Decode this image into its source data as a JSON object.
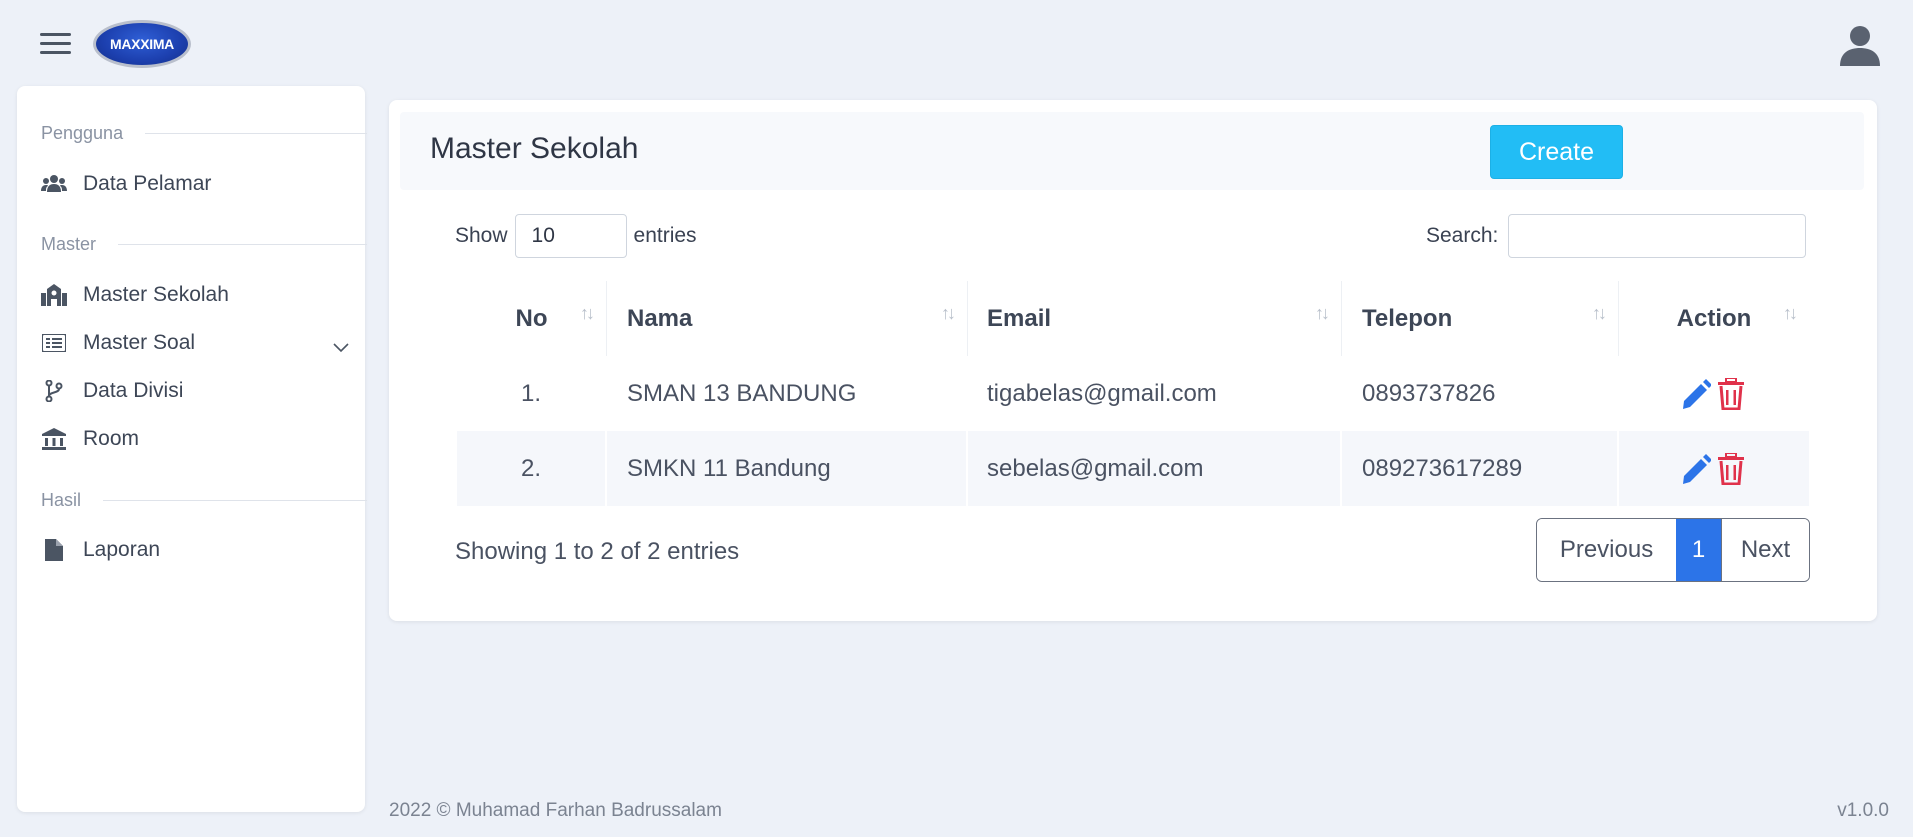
{
  "topbar": {
    "logo_text": "MAXXIMA",
    "icons": {
      "menu": "hamburger-icon",
      "user": "user-icon"
    }
  },
  "sidebar": {
    "sections": [
      {
        "title": "Pengguna",
        "items": [
          {
            "label": "Data Pelamar",
            "icon": "users-icon"
          }
        ]
      },
      {
        "title": "Master",
        "items": [
          {
            "label": "Master Sekolah",
            "icon": "school-icon"
          },
          {
            "label": "Master Soal",
            "icon": "list-icon",
            "has_submenu": true
          },
          {
            "label": "Data Divisi",
            "icon": "branch-icon"
          },
          {
            "label": "Room",
            "icon": "building-icon"
          }
        ]
      },
      {
        "title": "Hasil",
        "items": [
          {
            "label": "Laporan",
            "icon": "file-icon"
          }
        ]
      }
    ]
  },
  "main": {
    "title": "Master Sekolah",
    "create_label": "Create",
    "length": {
      "prefix": "Show",
      "value": "10",
      "suffix": "entries"
    },
    "search": {
      "label": "Search:",
      "value": ""
    },
    "table": {
      "columns": [
        "No",
        "Nama",
        "Email",
        "Telepon",
        "Action"
      ],
      "rows": [
        {
          "no": "1.",
          "nama": "SMAN 13 BANDUNG",
          "email": "tigabelas@gmail.com",
          "telepon": "0893737826"
        },
        {
          "no": "2.",
          "nama": "SMKN 11 Bandung",
          "email": "sebelas@gmail.com",
          "telepon": "089273617289"
        }
      ]
    },
    "info": "Showing 1 to 2 of 2 entries",
    "pagination": {
      "previous": "Previous",
      "current": "1",
      "next": "Next"
    }
  },
  "footer": {
    "copyright": "2022 © Muhamad Farhan Badrussalam",
    "version": "v1.0.0"
  },
  "colors": {
    "primary": "#2c74e8",
    "create": "#22bdf5",
    "delete": "#e0324b",
    "background": "#edf1f8"
  }
}
